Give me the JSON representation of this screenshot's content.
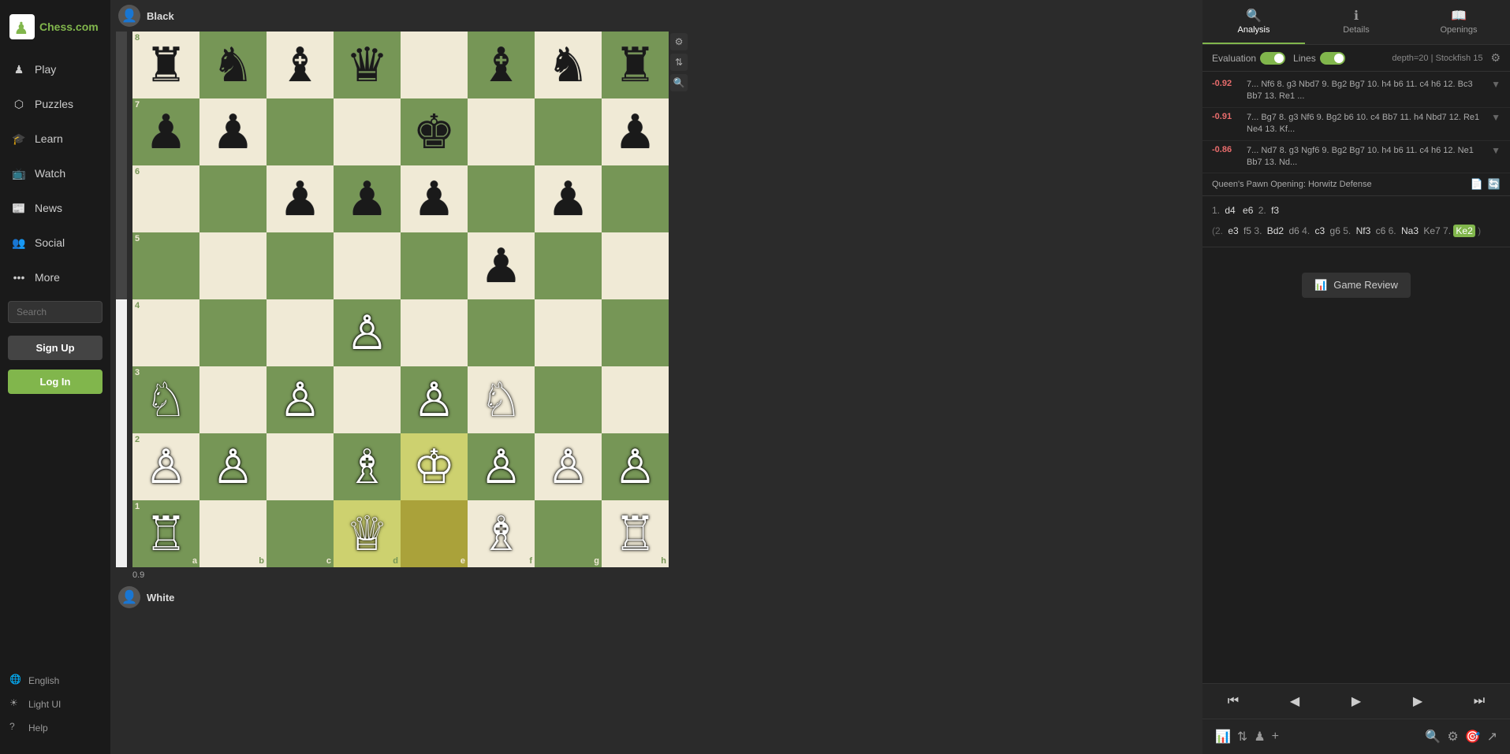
{
  "sidebar": {
    "logo_text": "Chess.com",
    "nav_items": [
      {
        "label": "Play",
        "icon": "♟",
        "name": "play"
      },
      {
        "label": "Puzzles",
        "icon": "🧩",
        "name": "puzzles"
      },
      {
        "label": "Learn",
        "icon": "🎓",
        "name": "learn"
      },
      {
        "label": "Watch",
        "icon": "👁",
        "name": "watch"
      },
      {
        "label": "News",
        "icon": "📰",
        "name": "news"
      },
      {
        "label": "Social",
        "icon": "👥",
        "name": "social"
      },
      {
        "label": "More",
        "icon": "•••",
        "name": "more"
      }
    ],
    "search_placeholder": "Search",
    "signup_label": "Sign Up",
    "login_label": "Log In",
    "bottom_items": [
      {
        "label": "English",
        "icon": "🌐"
      },
      {
        "label": "Light UI",
        "icon": "☀"
      },
      {
        "label": "Help",
        "icon": "?"
      }
    ]
  },
  "game": {
    "black_player": "Black",
    "white_player": "White",
    "eval_value": "0.9"
  },
  "analysis": {
    "tabs": [
      {
        "label": "Analysis",
        "icon": "🔍",
        "active": true
      },
      {
        "label": "Details",
        "icon": "ℹ",
        "active": false
      },
      {
        "label": "Openings",
        "icon": "📚",
        "active": false
      }
    ],
    "evaluation_label": "Evaluation",
    "lines_label": "Lines",
    "depth_text": "depth=20 | Stockfish 15",
    "lines": [
      {
        "score": "-0.92",
        "moves": "7... Nf6 8. g3 Nbd7 9. Bg2 Bg7 10. h4 b6 11. c4 h6 12. Bc3 Bb7 13. Re1 ..."
      },
      {
        "score": "-0.91",
        "moves": "7... Bg7 8. g3 Nf6 9. Bg2 b6 10. c4 Bb7 11. h4 Nbd7 12. Re1 Ne4 13. Kf..."
      },
      {
        "score": "-0.86",
        "moves": "7... Nd7 8. g3 Ngf6 9. Bg2 Bg7 10. h4 b6 11. c4 h6 12. Ne1 Bb7 13. Nd..."
      }
    ],
    "opening_name": "Queen's Pawn Opening: Horwitz Defense",
    "moves": {
      "move1_num": "1.",
      "move1_white": "d4",
      "move1_black_pre": "e6",
      "move1_space": "2.",
      "move1_white2": "f3"
    },
    "variation": "(2. e3 f5 3. Bd2 d6 4. c3 g6 5. Nf3 c6 6. Na3 Ke7 7. Ke2)",
    "variation_highlight": "Ke2",
    "game_review_label": "Game Review"
  },
  "nav_buttons": {
    "first": "⏮",
    "prev": "◀",
    "play": "▶",
    "next": "▶",
    "last": "⏭"
  },
  "board": {
    "ranks": [
      "8",
      "7",
      "6",
      "5",
      "4",
      "3",
      "2",
      "1"
    ],
    "files": [
      "a",
      "b",
      "c",
      "d",
      "e",
      "f",
      "g",
      "h"
    ]
  }
}
